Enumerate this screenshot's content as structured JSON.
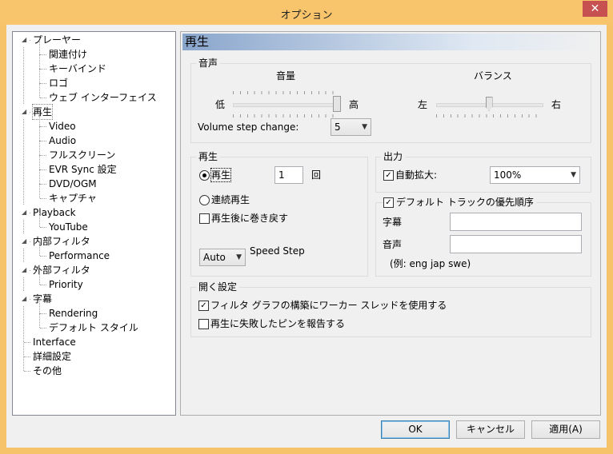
{
  "window": {
    "title": "オプション",
    "close_label": "✕"
  },
  "tree": [
    {
      "label": "プレーヤー",
      "level": 0,
      "expanded": true
    },
    {
      "label": "関連付け",
      "level": 1
    },
    {
      "label": "キーバインド",
      "level": 1
    },
    {
      "label": "ロゴ",
      "level": 1
    },
    {
      "label": "ウェブ インターフェイス",
      "level": 1
    },
    {
      "label": "再生",
      "level": 0,
      "expanded": true,
      "selected": true
    },
    {
      "label": "Video",
      "level": 1
    },
    {
      "label": "Audio",
      "level": 1
    },
    {
      "label": "フルスクリーン",
      "level": 1
    },
    {
      "label": "EVR Sync 設定",
      "level": 1
    },
    {
      "label": "DVD/OGM",
      "level": 1
    },
    {
      "label": "キャプチャ",
      "level": 1
    },
    {
      "label": "Playback",
      "level": 0,
      "expanded": true
    },
    {
      "label": "YouTube",
      "level": 1
    },
    {
      "label": "内部フィルタ",
      "level": 0,
      "expanded": true
    },
    {
      "label": "Performance",
      "level": 1
    },
    {
      "label": "外部フィルタ",
      "level": 0,
      "expanded": true
    },
    {
      "label": "Priority",
      "level": 1
    },
    {
      "label": "字幕",
      "level": 0,
      "expanded": true
    },
    {
      "label": "Rendering",
      "level": 1
    },
    {
      "label": "デフォルト スタイル",
      "level": 1
    },
    {
      "label": "Interface",
      "level": 0
    },
    {
      "label": "詳細設定",
      "level": 0
    },
    {
      "label": "その他",
      "level": 0
    }
  ],
  "panel": {
    "title": "再生"
  },
  "audio": {
    "group_label": "音声",
    "volume_label": "音量",
    "volume_low": "低",
    "volume_high": "高",
    "volume_value": 1.0,
    "balance_label": "バランス",
    "balance_left": "左",
    "balance_right": "右",
    "balance_value": 0.5,
    "step_label": "Volume step change:",
    "step_value": "5"
  },
  "playback": {
    "group_label": "再生",
    "play_label": "再生",
    "play_count": "1",
    "count_unit": "回",
    "repeat_label": "連続再生",
    "rewind_label": "再生後に巻き戻す",
    "speed_value": "Auto",
    "speed_label": "Speed Step"
  },
  "output": {
    "group_label": "出力",
    "autozoom_label": "自動拡大:",
    "autozoom_value": "100%"
  },
  "tracks": {
    "group_label": "デフォルト トラックの優先順序",
    "subtitle_label": "字幕",
    "subtitle_value": "",
    "audio_label": "音声",
    "audio_value": "",
    "example": "(例: eng jap swe)"
  },
  "open": {
    "group_label": "開く設定",
    "worker_label": "フィルタ グラフの構築にワーカー スレッドを使用する",
    "report_label": "再生に失敗したピンを報告する"
  },
  "buttons": {
    "ok": "OK",
    "cancel": "キャンセル",
    "apply": "適用(A)"
  },
  "checks": {
    "check_glyph": "✓"
  }
}
